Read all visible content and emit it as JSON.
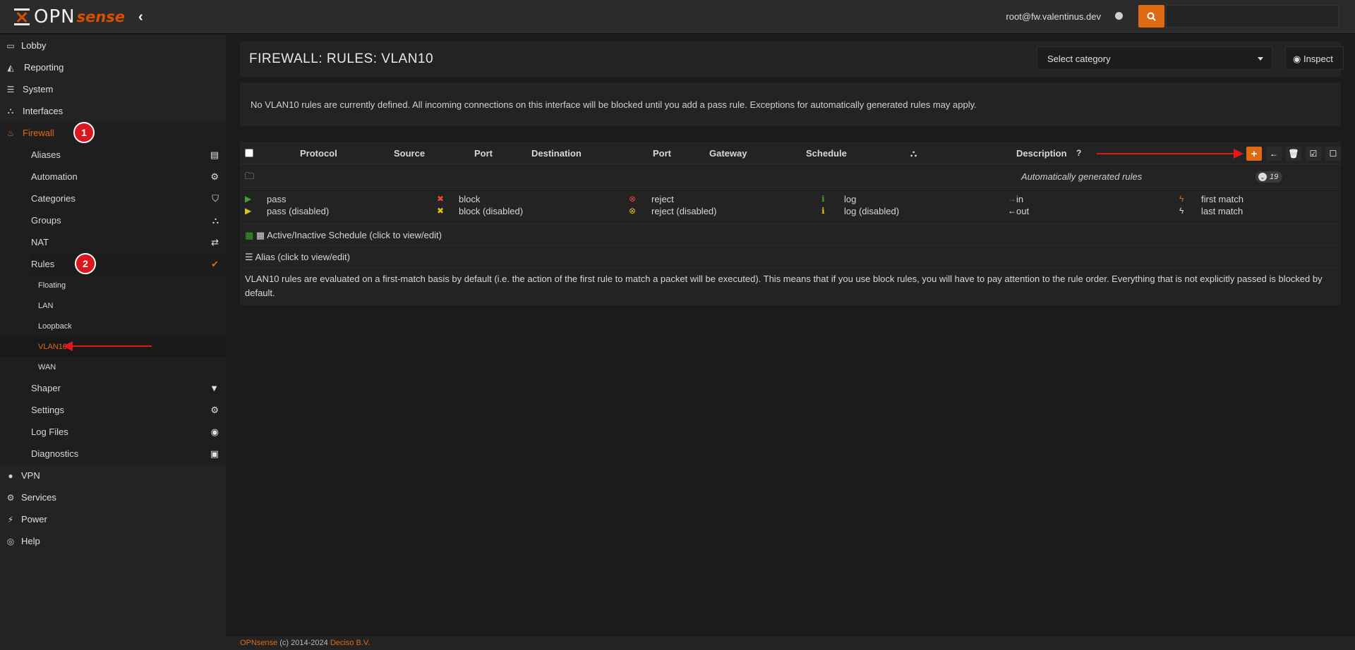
{
  "brand": {
    "opn": "OPN",
    "sense": "sense"
  },
  "header": {
    "user": "root@fw.valentinus.dev"
  },
  "sidebar": {
    "top": [
      {
        "label": "Lobby"
      },
      {
        "label": "Reporting"
      },
      {
        "label": "System"
      },
      {
        "label": "Interfaces"
      },
      {
        "label": "Firewall"
      }
    ],
    "firewall_items": [
      {
        "label": "Aliases"
      },
      {
        "label": "Automation"
      },
      {
        "label": "Categories"
      },
      {
        "label": "Groups"
      },
      {
        "label": "NAT"
      },
      {
        "label": "Rules"
      }
    ],
    "rules_items": [
      {
        "label": "Floating"
      },
      {
        "label": "LAN"
      },
      {
        "label": "Loopback"
      },
      {
        "label": "VLAN10"
      },
      {
        "label": "WAN"
      }
    ],
    "firewall_items2": [
      {
        "label": "Shaper"
      },
      {
        "label": "Settings"
      },
      {
        "label": "Log Files"
      },
      {
        "label": "Diagnostics"
      }
    ],
    "bottom": [
      {
        "label": "VPN"
      },
      {
        "label": "Services"
      },
      {
        "label": "Power"
      },
      {
        "label": "Help"
      }
    ]
  },
  "annotations": {
    "one": "1",
    "two": "2"
  },
  "page": {
    "title": "FIREWALL: RULES: VLAN10",
    "select_category": "Select category",
    "inspect": "Inspect",
    "notice": "No VLAN10 rules are currently defined. All incoming connections on this interface will be blocked until you add a pass rule. Exceptions for automatically generated rules may apply."
  },
  "table": {
    "headers": {
      "protocol": "Protocol",
      "source": "Source",
      "port1": "Port",
      "destination": "Destination",
      "port2": "Port",
      "gateway": "Gateway",
      "schedule": "Schedule",
      "description": "Description"
    },
    "auto_rules": "Automatically generated rules",
    "auto_count": "19",
    "legend": {
      "pass": "pass",
      "pass_disabled": "pass (disabled)",
      "block": "block",
      "block_disabled": "block (disabled)",
      "reject": "reject",
      "reject_disabled": "reject (disabled)",
      "log": "log",
      "log_disabled": "log (disabled)",
      "in": "in",
      "out": "out",
      "first_match": "first match",
      "last_match": "last match"
    },
    "schedule_link": "Active/Inactive Schedule (click to view/edit)",
    "alias_link": "Alias (click to view/edit)",
    "footnote": "VLAN10 rules are evaluated on a first-match basis by default (i.e. the action of the first rule to match a packet will be executed). This means that if you use block rules, you will have to pay attention to the rule order. Everything that is not explicitly passed is blocked by default."
  },
  "footer": {
    "brand": "OPNsense",
    "copy": " (c) 2014-2024 ",
    "company": "Deciso B.V."
  },
  "colors": {
    "accent": "#e06a13",
    "pass": "#3fa22b",
    "block": "#e0463a",
    "warn": "#e0c21a",
    "annotation": "#d9181e"
  }
}
